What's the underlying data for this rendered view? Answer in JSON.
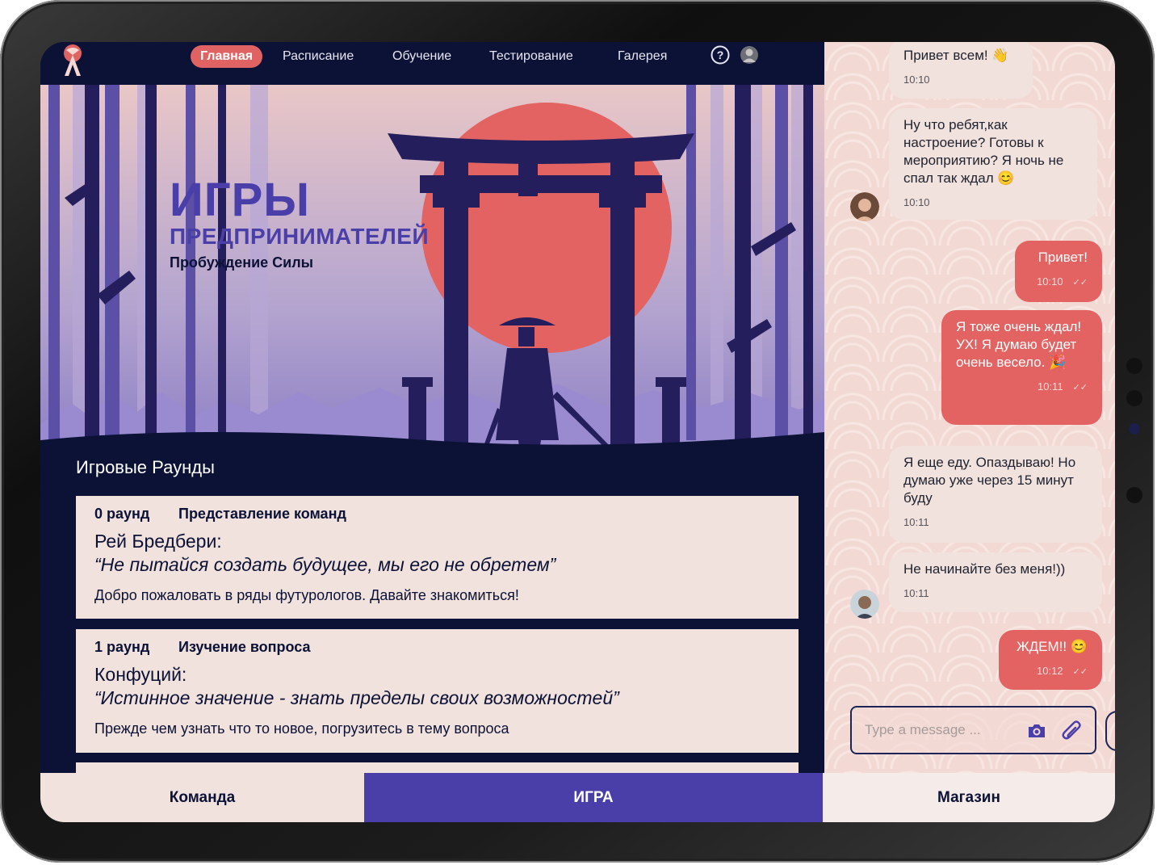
{
  "nav": {
    "items": [
      "Главная",
      "Расписание",
      "Обучение",
      "Тестирование",
      "Галерея"
    ],
    "help_icon": "question-circle-icon",
    "profile_icon": "user-avatar-icon"
  },
  "hero": {
    "title": "ИГРЫ",
    "subtitle": "ПРЕДПРИНИМАТЕЛЕЙ",
    "tagline": "Пробуждение Силы"
  },
  "rounds": {
    "heading": "Игровые Раунды",
    "items": [
      {
        "number": "0 раунд",
        "name": "Представление команд",
        "author": "Рей Бредбери:",
        "quote": "“Не пытайся создать будущее, мы его не обретем”",
        "description": "Добро пожаловать в ряды футурологов. Давайте знакомиться!"
      },
      {
        "number": "1 раунд",
        "name": "Изучение вопроса",
        "author": "Конфуций:",
        "quote": "“Истинное значение - знать пределы своих возможностей”",
        "description": "Прежде чем узнать что то новое, погрузитесь в тему вопроса"
      }
    ]
  },
  "chat": {
    "messages": [
      {
        "direction": "in",
        "text": "Привет всем! 👋",
        "time": "10:10"
      },
      {
        "direction": "in",
        "text": "Ну что ребят,как настроение? Готовы к мероприятию? Я ночь не спал так ждал 😊",
        "time": "10:10"
      },
      {
        "direction": "out",
        "text": "Привет!",
        "time": "10:10"
      },
      {
        "direction": "out",
        "text": "Я тоже очень ждал! УХ! Я думаю будет очень весело. 🎉",
        "time": "10:11"
      },
      {
        "direction": "in",
        "text": "Я еще еду. Опаздываю! Но думаю уже через 15 минут буду",
        "time": "10:11"
      },
      {
        "direction": "in",
        "text": "Не начинайте без меня!))",
        "time": "10:11"
      },
      {
        "direction": "out",
        "text": "ЖДЕМ!! 😊",
        "time": "10:12"
      }
    ],
    "input_placeholder": "Type a message ...",
    "camera_icon": "camera-icon",
    "attach_icon": "paperclip-icon"
  },
  "tabs": [
    "Команда",
    "ИГРА",
    "Магазин"
  ],
  "colors": {
    "navy": "#0b1236",
    "accent_red": "#e26362",
    "purple": "#4a3fa8",
    "card_bg": "#f1e2dd",
    "chat_bg": "#f3d9d3"
  }
}
